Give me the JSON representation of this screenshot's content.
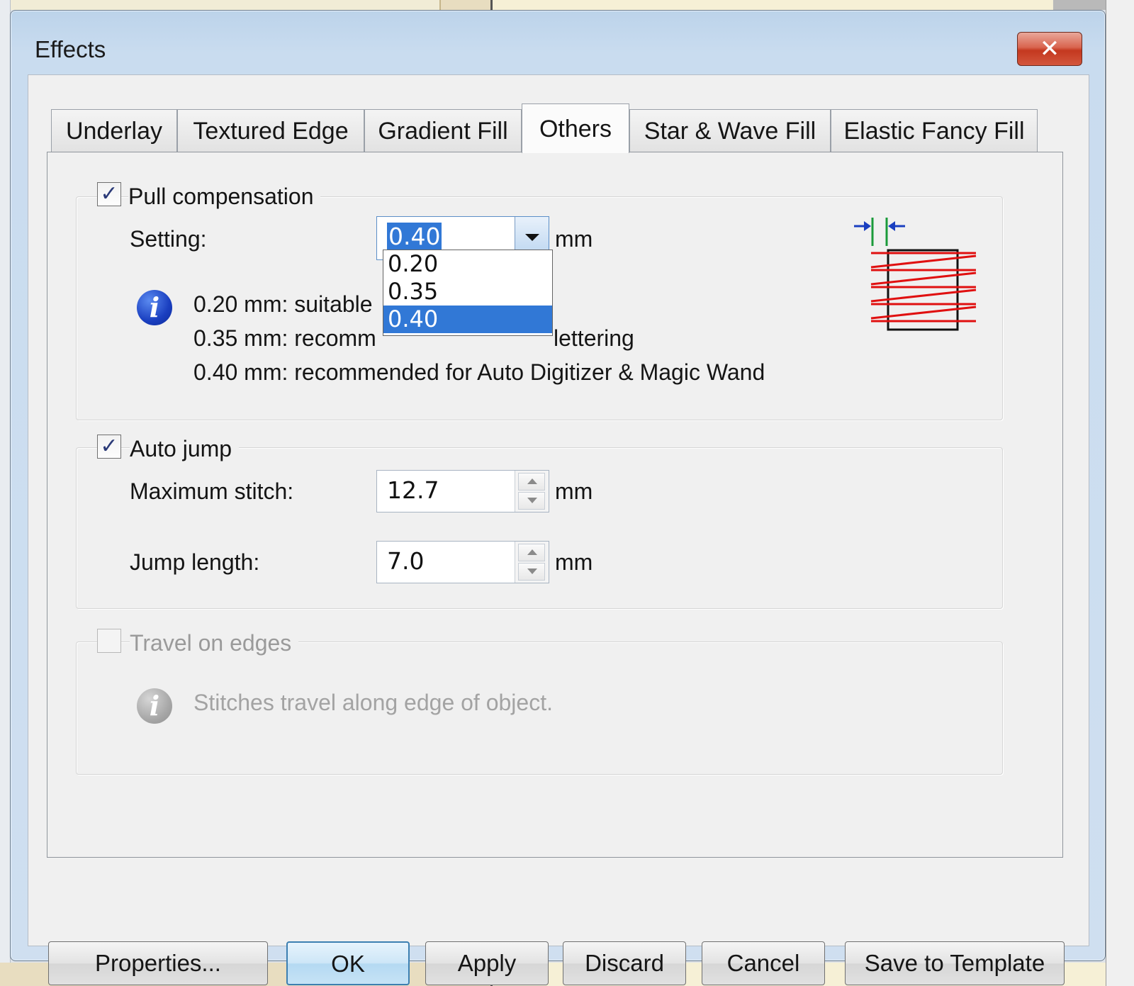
{
  "window": {
    "title": "Effects",
    "close_glyph": "✕"
  },
  "tabs": [
    {
      "label": "Underlay"
    },
    {
      "label": "Textured Edge"
    },
    {
      "label": "Gradient Fill"
    },
    {
      "label": "Others",
      "active": true
    },
    {
      "label": "Star & Wave Fill"
    },
    {
      "label": "Elastic Fancy Fill"
    }
  ],
  "pull_compensation": {
    "label": "Pull compensation",
    "checked": true,
    "setting_label": "Setting:",
    "value": "0.40",
    "unit": "mm",
    "options": [
      "0.20",
      "0.35",
      "0.40"
    ],
    "selected_option": "0.40",
    "info_lines": [
      "0.20 mm: suitable",
      "0.35 mm: recomm",
      "0.40 mm: recommended for Auto Digitizer & Magic Wand"
    ],
    "info_line2_tail": "lettering"
  },
  "auto_jump": {
    "label": "Auto jump",
    "checked": true,
    "max_stitch_label": "Maximum stitch:",
    "max_stitch_value": "12.7",
    "jump_length_label": "Jump length:",
    "jump_length_value": "7.0",
    "unit": "mm"
  },
  "travel_on_edges": {
    "label": "Travel on edges",
    "checked": false,
    "enabled": false,
    "info": "Stitches travel along edge of object."
  },
  "buttons": {
    "properties": "Properties...",
    "ok": "OK",
    "apply": "Apply",
    "discard": "Discard",
    "cancel": "Cancel",
    "save_to_template": "Save to Template"
  },
  "icons": {
    "info": "info-icon",
    "checkmark": "✓",
    "pull_diagram": "pull-compensation-diagram-icon"
  },
  "colors": {
    "selection": "#3178d6",
    "diagram_red": "#e01010",
    "diagram_blue": "#1a3fc0",
    "diagram_green": "#1a9a3a"
  }
}
